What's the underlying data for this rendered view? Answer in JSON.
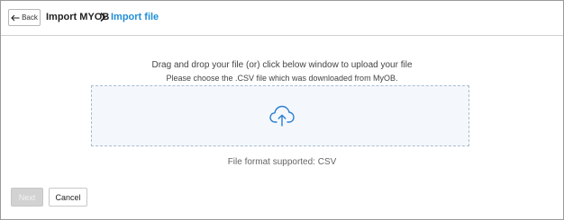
{
  "header": {
    "back_label": "Back",
    "parent_title": "Import MYOB",
    "current_title": "Import file"
  },
  "upload": {
    "instruction": "Drag and drop your file (or) click below window to upload your file",
    "subinstruction": "Please choose the .CSV file which was downloaded from MyOB.",
    "format_note": "File format supported: CSV"
  },
  "footer": {
    "next_label": "Next",
    "cancel_label": "Cancel"
  },
  "icons": {
    "back": "arrow-left-icon",
    "separator": "chevron-right-icon",
    "upload": "cloud-upload-icon"
  },
  "colors": {
    "accent": "#1f8ed6",
    "dropzone_bg": "#f4f8fd",
    "dropzone_border": "#a9bcd2",
    "disabled_button": "#d2d2d2"
  }
}
